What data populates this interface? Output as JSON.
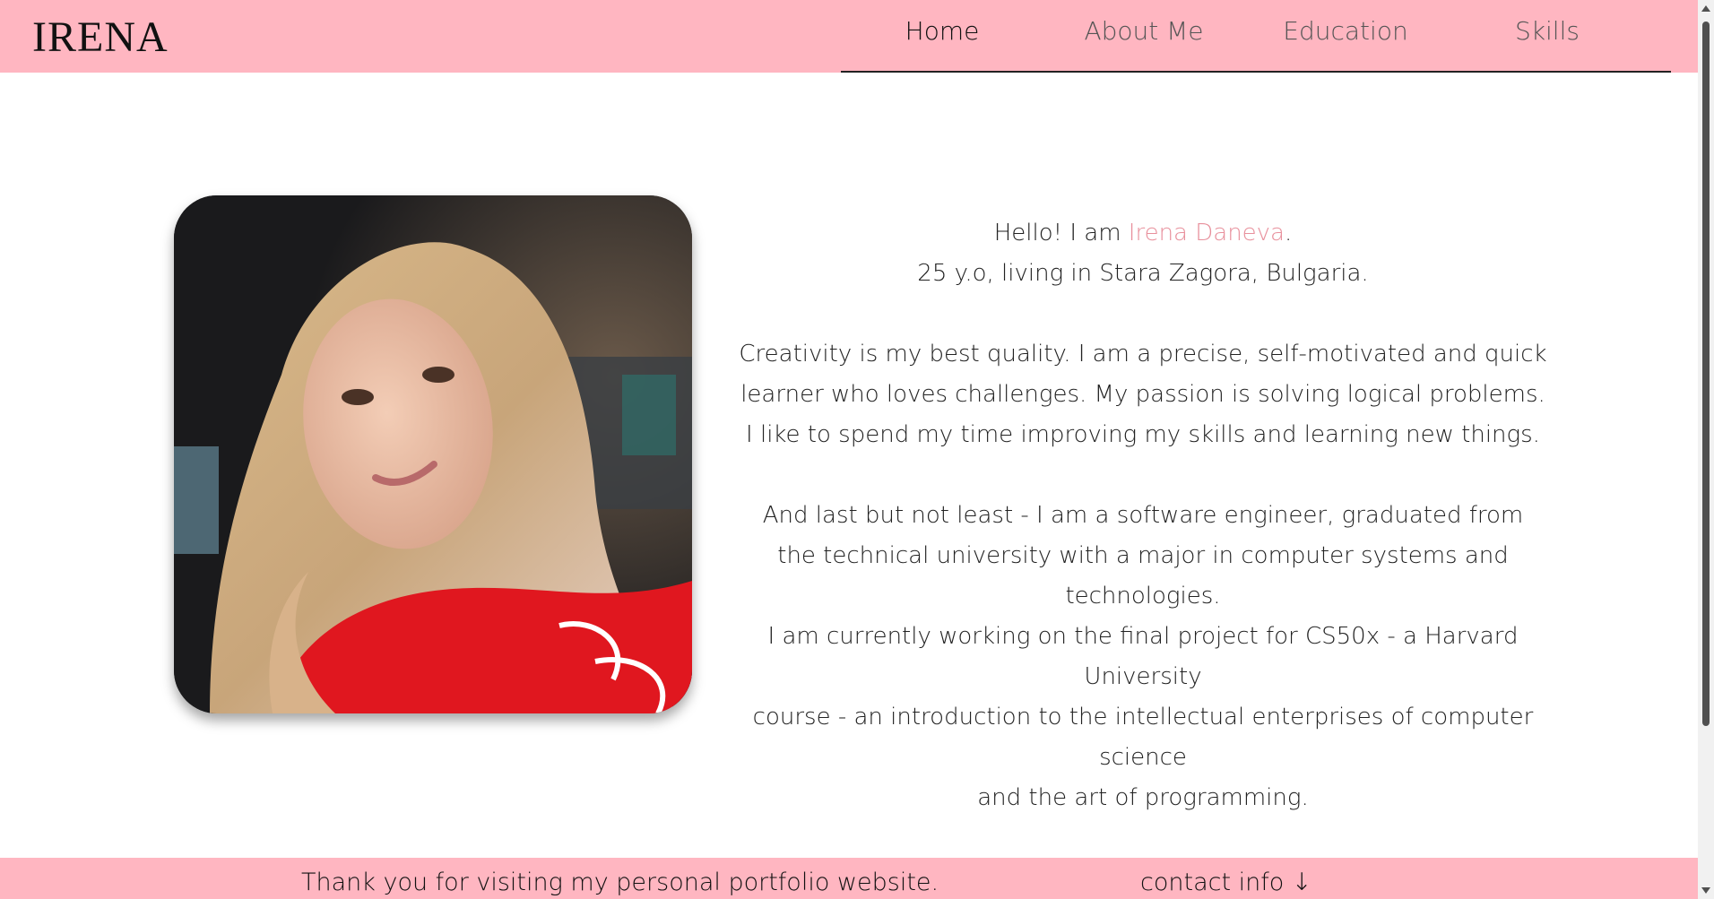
{
  "header": {
    "logo": "IRENA",
    "nav": [
      {
        "label": "Home",
        "active": true
      },
      {
        "label": "About Me",
        "active": false
      },
      {
        "label": "Education",
        "active": false
      },
      {
        "label": "Skills",
        "active": false
      }
    ]
  },
  "intro": {
    "greeting_prefix": "Hello! I am ",
    "name": "Irena Daneva",
    "greeting_suffix": ".",
    "age_location": "25 y.o, living in Stara Zagora, Bulgaria.",
    "paragraph2": [
      "Creativity is my best quality. I am a precise, self-motivated and quick",
      "learner who loves challenges. My passion is solving logical problems.",
      "I like to spend my time improving my skills and learning new things."
    ],
    "paragraph3": [
      "And last but not least - I am a software engineer, graduated from",
      "the technical university with a major in computer systems and technologies.",
      "I am currently working on the final project for CS50x - a Harvard University",
      "course - an introduction to the intellectual enterprises of computer science",
      "and the art of programming."
    ]
  },
  "footer": {
    "message": "Thank you for visiting my personal portfolio website.",
    "contact_label": "contact info",
    "contact_arrow": "↓"
  },
  "colors": {
    "header_bg": "#ffb6c1",
    "accent": "#e8909c"
  },
  "icons": {
    "contact_arrow": "arrow-down-icon"
  }
}
